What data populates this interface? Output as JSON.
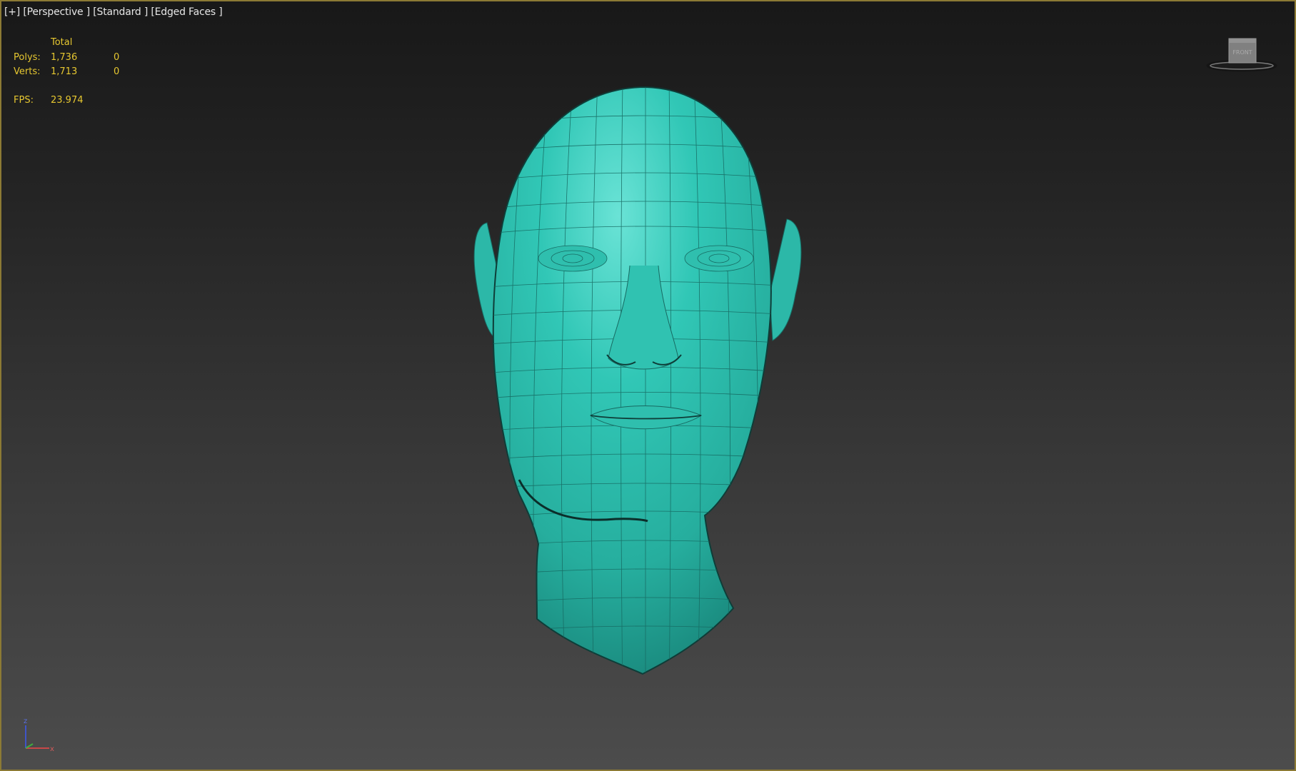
{
  "viewport": {
    "label": {
      "plus_menu": "[+]",
      "pov_menu": "[Perspective ]",
      "shading_menu": "[Standard ]",
      "display_menu": "[Edged Faces ]"
    },
    "stats": {
      "header": "Total",
      "polys_label": "Polys:",
      "polys_total": "1,736",
      "polys_selected": "0",
      "verts_label": "Verts:",
      "verts_total": "1,713",
      "verts_selected": "0",
      "fps_label": "FPS:",
      "fps_value": "23.974"
    },
    "viewcube": {
      "face": "FRONT"
    },
    "axis": {
      "z": "z",
      "x": "x"
    }
  },
  "colors": {
    "model": "#2fc4b3",
    "wireframe": "#176a62",
    "stats_text": "#e6c730",
    "label_text": "#e6e6e6",
    "active_border": "#8c7a34"
  },
  "icons": [
    "viewcube-icon",
    "axis-tripod-icon"
  ]
}
